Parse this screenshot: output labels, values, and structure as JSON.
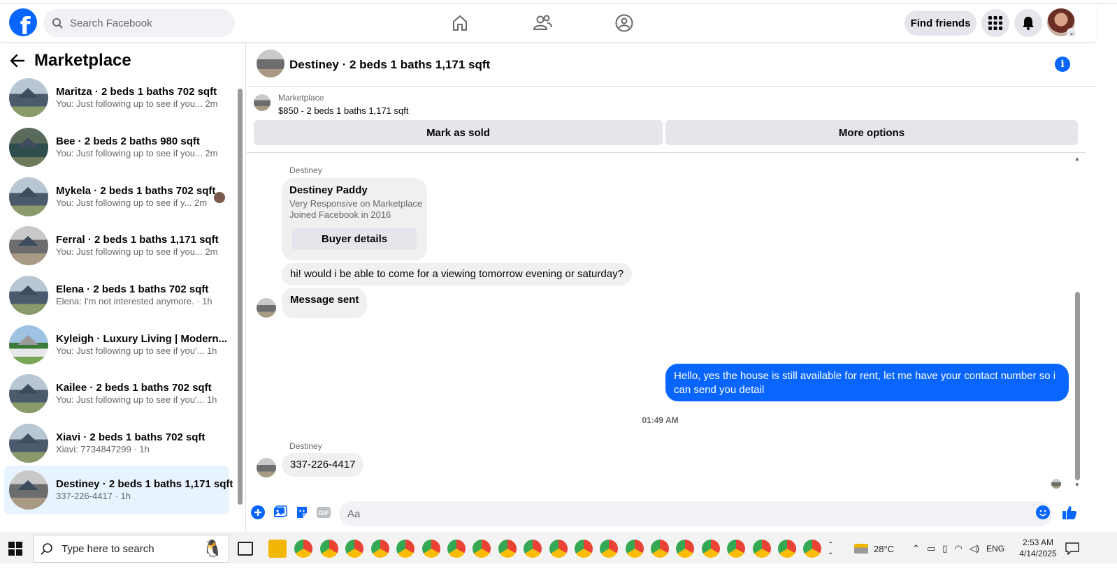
{
  "header": {
    "search_placeholder": "Search Facebook",
    "find_friends": "Find friends",
    "icons": [
      "home-icon",
      "friends-icon",
      "groups-icon",
      "menu-grid-icon",
      "bell-icon"
    ],
    "accent": "#0866ff"
  },
  "sidebar": {
    "title": "Marketplace",
    "conversations": [
      {
        "title": "Maritza · 2 beds 1 baths 702 sqft",
        "preview": "You: Just following up to see if you...",
        "time": "2m"
      },
      {
        "title": "Bee · 2 beds 2 baths 980 sqft",
        "preview": "You: Just following up to see if you...",
        "time": "2m"
      },
      {
        "title": "Mykela · 2 beds 1 baths 702 sqft",
        "preview": "You: Just following up to see if y...",
        "time": "2m"
      },
      {
        "title": "Ferral · 2 beds 1 baths 1,171 sqft",
        "preview": "You: Just following up to see if you...",
        "time": "2m"
      },
      {
        "title": "Elena · 2 beds 1 baths 702 sqft",
        "preview": "Elena: I'm not interested anymore.",
        "time": "1h"
      },
      {
        "title": "Kyleigh · Luxury Living | Modern...",
        "preview": "You: Just following up to see if you'...",
        "time": "1h"
      },
      {
        "title": "Kailee · 2 beds 1 baths 702 sqft",
        "preview": "You: Just following up to see if you'...",
        "time": "1h"
      },
      {
        "title": "Xiavi · 2 beds 1 baths 702 sqft",
        "preview": "Xiavi: 7734847299",
        "time": "1h"
      },
      {
        "title": "Destiney · 2 beds 1 baths 1,171 sqft",
        "preview": "337-226-4417",
        "time": "1h"
      }
    ]
  },
  "chat": {
    "title": "Destiney · 2 beds 1 baths 1,171 sqft",
    "listing_source": "Marketplace",
    "listing_price": "$850 - 2 beds 1 baths 1,171 sqft",
    "mark_sold": "Mark as sold",
    "more_options": "More options",
    "sender1": "Destiney",
    "card_name": "Destiney Paddy",
    "card_line1": "Very Responsive on Marketplace",
    "card_line2": "Joined Facebook in 2016",
    "buyer_details": "Buyer details",
    "msg1": "hi! would i be able to come for a viewing tomorrow evening or saturday?",
    "msg2": "Message sent",
    "out_msg": "Hello, yes the house is still available for rent, let me have your contact number so i can send you detail",
    "timestamp": "01:49 AM",
    "sender2": "Destiney",
    "msg3": "337-226-4417",
    "composer_placeholder": "Aa"
  },
  "taskbar": {
    "search_placeholder": "Type here to search",
    "weather": "28°C",
    "lang": "ENG",
    "time": "2:53 AM",
    "date": "4/14/2025"
  }
}
